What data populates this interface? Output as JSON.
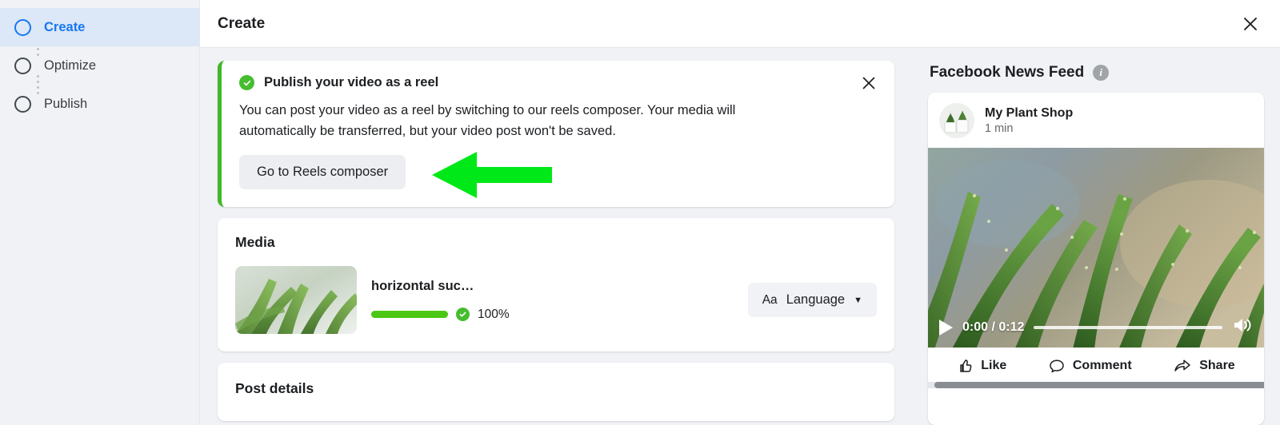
{
  "sidebar": {
    "steps": [
      {
        "label": "Create",
        "state": "active",
        "icon": "circle-icon"
      },
      {
        "label": "Optimize",
        "state": "inactive",
        "icon": "circle-icon"
      },
      {
        "label": "Publish",
        "state": "inactive",
        "icon": "circle-icon"
      }
    ]
  },
  "topbar": {
    "title": "Create",
    "close_icon": "close-icon"
  },
  "banner": {
    "icon": "check-circle-icon",
    "title": "Publish your video as a reel",
    "body": "You can post your video as a reel by switching to our reels composer. Your media will automatically be transferred, but your video post won't be saved.",
    "button_label": "Go to Reels composer",
    "close_icon": "close-icon",
    "accent_color": "#42b72a"
  },
  "media": {
    "section_title": "Media",
    "file_name": "horizontal suc…",
    "progress_percent": 100,
    "progress_label": "100%",
    "progress_color": "#4cc713",
    "status_icon": "check-circle-icon",
    "language_button": {
      "aa_label": "Aa",
      "label": "Language",
      "caret_icon": "chevron-down-icon"
    }
  },
  "post_details": {
    "section_title": "Post details"
  },
  "preview": {
    "title": "Facebook News Feed",
    "info_icon": "info-icon",
    "info_glyph": "i",
    "post": {
      "page_name": "My Plant Shop",
      "timestamp": "1 min",
      "avatar_icon": "avatar"
    },
    "video": {
      "play_icon": "play-icon",
      "time_display": "0:00 / 0:12",
      "current_time": "0:00",
      "duration": "0:12",
      "volume_icon": "volume-icon",
      "progress_percent": 0
    },
    "actions": [
      {
        "label": "Like",
        "icon": "thumbs-up-icon"
      },
      {
        "label": "Comment",
        "icon": "comment-bubble-icon"
      },
      {
        "label": "Share",
        "icon": "share-arrow-icon"
      }
    ]
  },
  "annotation": {
    "type": "arrow",
    "direction": "left",
    "color": "#00e817",
    "points_to": "Go to Reels composer"
  }
}
